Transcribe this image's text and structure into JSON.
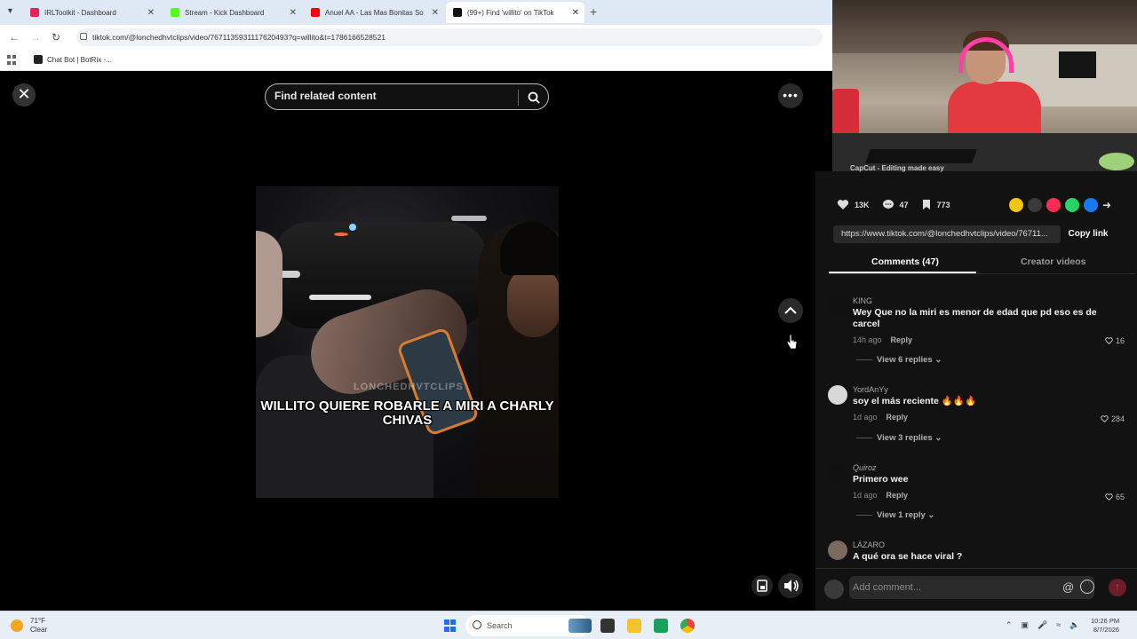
{
  "browser": {
    "tabs": [
      {
        "title": "IRLToolkit - Dashboard",
        "favicon_color": "#e0245e"
      },
      {
        "title": "Stream - Kick Dashboard",
        "favicon_color": "#53fc18"
      },
      {
        "title": "Anuel AA - Las Mas Bonitas So",
        "favicon_color": "#ff0000"
      },
      {
        "title": "(99+) Find 'willito' on TikTok",
        "favicon_color": "#111111",
        "active": true
      }
    ],
    "url": "tiktok.com/@lonchedhvtclips/video/7671135931117620493?q=willito&t=1786166528521",
    "bookmarks": [
      {
        "label": "Chat Bot | BotRix -..."
      }
    ]
  },
  "viewer": {
    "search_placeholder": "Find related content",
    "video_caption": "WILLITO QUIERE ROBARLE A MIRI A CHARLY CHIVAS",
    "watermark": "LONCHEDHVTCLIPS"
  },
  "webcam_banner": "CapCut - Editing made easy",
  "panel": {
    "likes": "13K",
    "comments_count": "47",
    "saves": "773",
    "share_link": "https://www.tiktok.com/@lonchedhvtclips/video/76711...",
    "copy_link_label": "Copy link",
    "tabs": [
      {
        "label": "Comments (47)",
        "active": true
      },
      {
        "label": "Creator videos",
        "active": false
      }
    ],
    "comments": [
      {
        "user": "KING",
        "text": "Wey Que no la miri es menor de edad que pd eso es de carcel",
        "time": "14h ago",
        "reply": "Reply",
        "likes": "16",
        "replies": "View 6 replies"
      },
      {
        "user": "YordAnYy",
        "text": "soy el más reciente 🔥🔥🔥",
        "time": "1d ago",
        "reply": "Reply",
        "likes": "284",
        "replies": "View 3 replies"
      },
      {
        "user": "Quiroz",
        "text": "Primero wee",
        "time": "1d ago",
        "reply": "Reply",
        "likes": "65",
        "replies": "View 1 reply"
      },
      {
        "user": "LÁZARO",
        "text": "A qué ora se hace viral ?",
        "time": "",
        "reply": "",
        "likes": "",
        "replies": ""
      }
    ],
    "add_comment_placeholder": "Add comment...",
    "at_symbol": "@"
  },
  "taskbar": {
    "weather_temp": "71°F",
    "weather_desc": "Clear",
    "search_label": "Search",
    "time": "10:26 PM",
    "date": "8/7/2026"
  },
  "icons": {
    "close": "close-icon",
    "more": "more-icon",
    "search": "search-icon",
    "up": "chevron-up-icon",
    "volume": "volume-icon",
    "pip": "pip-icon",
    "heart": "heart-icon",
    "comment": "comment-icon",
    "bookmark": "bookmark-icon"
  }
}
